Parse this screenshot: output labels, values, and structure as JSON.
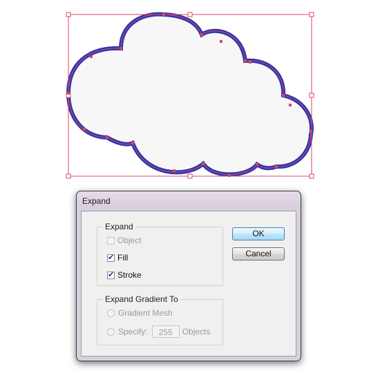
{
  "artwork": {
    "shape": "cloud",
    "fill_color": "#f7f7f7",
    "stroke_color": "#2b37b3",
    "selection_color": "#e0455a"
  },
  "dialog": {
    "title": "Expand",
    "expand_group": {
      "legend": "Expand",
      "object": {
        "label": "Object",
        "checked": false,
        "enabled": false
      },
      "fill": {
        "label": "Fill",
        "checked": true,
        "enabled": true
      },
      "stroke": {
        "label": "Stroke",
        "checked": true,
        "enabled": true
      }
    },
    "gradient_group": {
      "legend": "Expand Gradient To",
      "gradient_mesh": {
        "label": "Gradient Mesh",
        "enabled": false
      },
      "specify": {
        "label": "Specify:",
        "value": "255",
        "unit": "Objects",
        "enabled": false
      }
    },
    "ok_label": "OK",
    "cancel_label": "Cancel"
  }
}
